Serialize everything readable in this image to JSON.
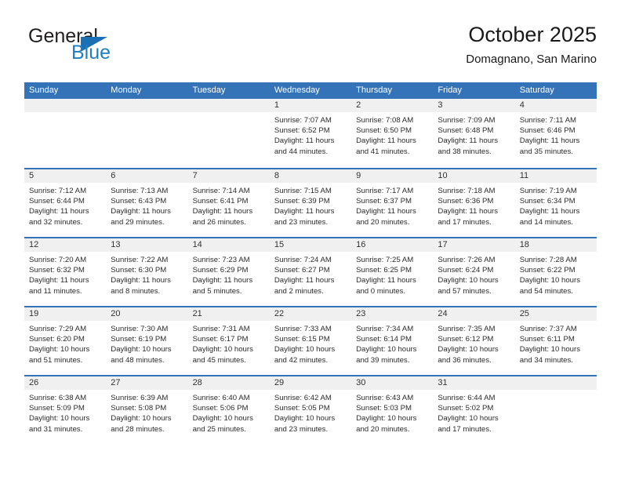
{
  "brand": {
    "name_top": "General",
    "name_bottom": "Blue",
    "color_dark": "#231f20",
    "color_blue": "#1d7fc4"
  },
  "header": {
    "title": "October 2025",
    "subtitle": "Domagnano, San Marino"
  },
  "theme": {
    "header_blue": "#3573b9",
    "day_band_gray": "#f0f0f0",
    "text": "#2b2b2b"
  },
  "weekdays": [
    "Sunday",
    "Monday",
    "Tuesday",
    "Wednesday",
    "Thursday",
    "Friday",
    "Saturday"
  ],
  "weeks": [
    [
      {
        "day": "",
        "empty": true
      },
      {
        "day": "",
        "empty": true
      },
      {
        "day": "",
        "empty": true
      },
      {
        "day": "1",
        "sunrise": "Sunrise: 7:07 AM",
        "sunset": "Sunset: 6:52 PM",
        "daylight": "Daylight: 11 hours and 44 minutes."
      },
      {
        "day": "2",
        "sunrise": "Sunrise: 7:08 AM",
        "sunset": "Sunset: 6:50 PM",
        "daylight": "Daylight: 11 hours and 41 minutes."
      },
      {
        "day": "3",
        "sunrise": "Sunrise: 7:09 AM",
        "sunset": "Sunset: 6:48 PM",
        "daylight": "Daylight: 11 hours and 38 minutes."
      },
      {
        "day": "4",
        "sunrise": "Sunrise: 7:11 AM",
        "sunset": "Sunset: 6:46 PM",
        "daylight": "Daylight: 11 hours and 35 minutes."
      }
    ],
    [
      {
        "day": "5",
        "sunrise": "Sunrise: 7:12 AM",
        "sunset": "Sunset: 6:44 PM",
        "daylight": "Daylight: 11 hours and 32 minutes."
      },
      {
        "day": "6",
        "sunrise": "Sunrise: 7:13 AM",
        "sunset": "Sunset: 6:43 PM",
        "daylight": "Daylight: 11 hours and 29 minutes."
      },
      {
        "day": "7",
        "sunrise": "Sunrise: 7:14 AM",
        "sunset": "Sunset: 6:41 PM",
        "daylight": "Daylight: 11 hours and 26 minutes."
      },
      {
        "day": "8",
        "sunrise": "Sunrise: 7:15 AM",
        "sunset": "Sunset: 6:39 PM",
        "daylight": "Daylight: 11 hours and 23 minutes."
      },
      {
        "day": "9",
        "sunrise": "Sunrise: 7:17 AM",
        "sunset": "Sunset: 6:37 PM",
        "daylight": "Daylight: 11 hours and 20 minutes."
      },
      {
        "day": "10",
        "sunrise": "Sunrise: 7:18 AM",
        "sunset": "Sunset: 6:36 PM",
        "daylight": "Daylight: 11 hours and 17 minutes."
      },
      {
        "day": "11",
        "sunrise": "Sunrise: 7:19 AM",
        "sunset": "Sunset: 6:34 PM",
        "daylight": "Daylight: 11 hours and 14 minutes."
      }
    ],
    [
      {
        "day": "12",
        "sunrise": "Sunrise: 7:20 AM",
        "sunset": "Sunset: 6:32 PM",
        "daylight": "Daylight: 11 hours and 11 minutes."
      },
      {
        "day": "13",
        "sunrise": "Sunrise: 7:22 AM",
        "sunset": "Sunset: 6:30 PM",
        "daylight": "Daylight: 11 hours and 8 minutes."
      },
      {
        "day": "14",
        "sunrise": "Sunrise: 7:23 AM",
        "sunset": "Sunset: 6:29 PM",
        "daylight": "Daylight: 11 hours and 5 minutes."
      },
      {
        "day": "15",
        "sunrise": "Sunrise: 7:24 AM",
        "sunset": "Sunset: 6:27 PM",
        "daylight": "Daylight: 11 hours and 2 minutes."
      },
      {
        "day": "16",
        "sunrise": "Sunrise: 7:25 AM",
        "sunset": "Sunset: 6:25 PM",
        "daylight": "Daylight: 11 hours and 0 minutes."
      },
      {
        "day": "17",
        "sunrise": "Sunrise: 7:26 AM",
        "sunset": "Sunset: 6:24 PM",
        "daylight": "Daylight: 10 hours and 57 minutes."
      },
      {
        "day": "18",
        "sunrise": "Sunrise: 7:28 AM",
        "sunset": "Sunset: 6:22 PM",
        "daylight": "Daylight: 10 hours and 54 minutes."
      }
    ],
    [
      {
        "day": "19",
        "sunrise": "Sunrise: 7:29 AM",
        "sunset": "Sunset: 6:20 PM",
        "daylight": "Daylight: 10 hours and 51 minutes."
      },
      {
        "day": "20",
        "sunrise": "Sunrise: 7:30 AM",
        "sunset": "Sunset: 6:19 PM",
        "daylight": "Daylight: 10 hours and 48 minutes."
      },
      {
        "day": "21",
        "sunrise": "Sunrise: 7:31 AM",
        "sunset": "Sunset: 6:17 PM",
        "daylight": "Daylight: 10 hours and 45 minutes."
      },
      {
        "day": "22",
        "sunrise": "Sunrise: 7:33 AM",
        "sunset": "Sunset: 6:15 PM",
        "daylight": "Daylight: 10 hours and 42 minutes."
      },
      {
        "day": "23",
        "sunrise": "Sunrise: 7:34 AM",
        "sunset": "Sunset: 6:14 PM",
        "daylight": "Daylight: 10 hours and 39 minutes."
      },
      {
        "day": "24",
        "sunrise": "Sunrise: 7:35 AM",
        "sunset": "Sunset: 6:12 PM",
        "daylight": "Daylight: 10 hours and 36 minutes."
      },
      {
        "day": "25",
        "sunrise": "Sunrise: 7:37 AM",
        "sunset": "Sunset: 6:11 PM",
        "daylight": "Daylight: 10 hours and 34 minutes."
      }
    ],
    [
      {
        "day": "26",
        "sunrise": "Sunrise: 6:38 AM",
        "sunset": "Sunset: 5:09 PM",
        "daylight": "Daylight: 10 hours and 31 minutes."
      },
      {
        "day": "27",
        "sunrise": "Sunrise: 6:39 AM",
        "sunset": "Sunset: 5:08 PM",
        "daylight": "Daylight: 10 hours and 28 minutes."
      },
      {
        "day": "28",
        "sunrise": "Sunrise: 6:40 AM",
        "sunset": "Sunset: 5:06 PM",
        "daylight": "Daylight: 10 hours and 25 minutes."
      },
      {
        "day": "29",
        "sunrise": "Sunrise: 6:42 AM",
        "sunset": "Sunset: 5:05 PM",
        "daylight": "Daylight: 10 hours and 23 minutes."
      },
      {
        "day": "30",
        "sunrise": "Sunrise: 6:43 AM",
        "sunset": "Sunset: 5:03 PM",
        "daylight": "Daylight: 10 hours and 20 minutes."
      },
      {
        "day": "31",
        "sunrise": "Sunrise: 6:44 AM",
        "sunset": "Sunset: 5:02 PM",
        "daylight": "Daylight: 10 hours and 17 minutes."
      },
      {
        "day": "",
        "empty": true
      }
    ]
  ]
}
